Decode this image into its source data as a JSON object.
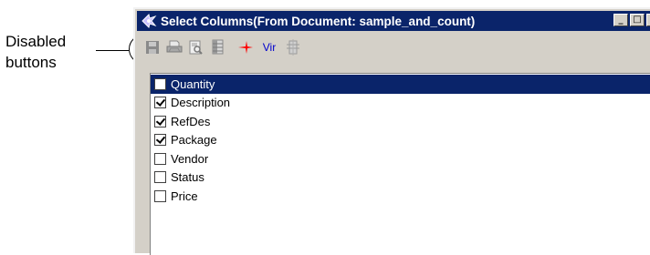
{
  "callout": {
    "label": "Disabled buttons"
  },
  "window": {
    "title": "Select Columns(From Document: sample_and_count)",
    "controls": {
      "minimize": "_",
      "maximize": "□",
      "close": "X"
    }
  },
  "toolbar": {
    "buttons": [
      {
        "name": "save",
        "icon": "floppy-disk-icon",
        "enabled": false
      },
      {
        "name": "print",
        "icon": "printer-icon",
        "enabled": false
      },
      {
        "name": "preview",
        "icon": "print-preview-icon",
        "enabled": false
      },
      {
        "name": "export",
        "icon": "spreadsheet-icon",
        "enabled": false
      },
      {
        "name": "red-star",
        "icon": "red-star-icon",
        "enabled": true
      },
      {
        "name": "vir",
        "label": "Vir",
        "enabled": true
      },
      {
        "name": "clip",
        "icon": "clip-icon",
        "enabled": false
      }
    ]
  },
  "columns": [
    {
      "label": "Quantity",
      "checked": false,
      "selected": true
    },
    {
      "label": "Description",
      "checked": true,
      "selected": false
    },
    {
      "label": "RefDes",
      "checked": true,
      "selected": false
    },
    {
      "label": "Package",
      "checked": true,
      "selected": false
    },
    {
      "label": "Vendor",
      "checked": false,
      "selected": false
    },
    {
      "label": "Status",
      "checked": false,
      "selected": false
    },
    {
      "label": "Price",
      "checked": false,
      "selected": false
    }
  ],
  "colors": {
    "titlebar": "#0a246a",
    "face": "#d4d0c8",
    "accent_red": "#ff0000",
    "link_blue": "#0000cc"
  }
}
